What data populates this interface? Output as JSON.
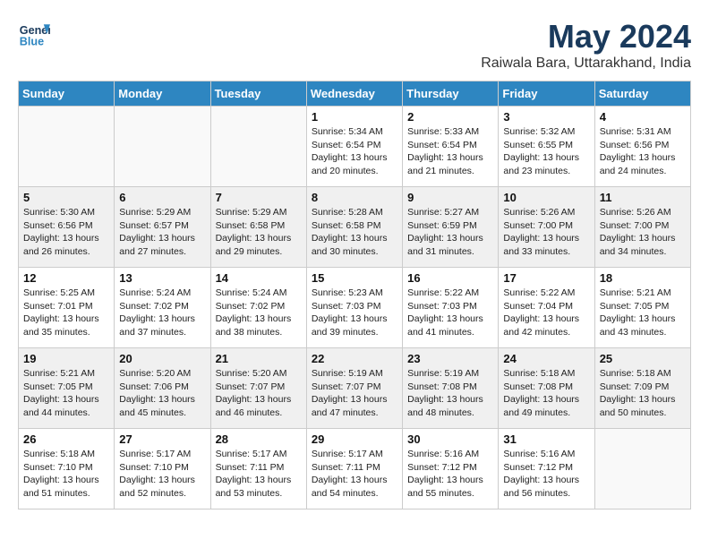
{
  "logo": {
    "line1": "General",
    "line2": "Blue"
  },
  "title": "May 2024",
  "location": "Raiwala Bara, Uttarakhand, India",
  "weekdays": [
    "Sunday",
    "Monday",
    "Tuesday",
    "Wednesday",
    "Thursday",
    "Friday",
    "Saturday"
  ],
  "weeks": [
    [
      {
        "day": "",
        "info": ""
      },
      {
        "day": "",
        "info": ""
      },
      {
        "day": "",
        "info": ""
      },
      {
        "day": "1",
        "info": "Sunrise: 5:34 AM\nSunset: 6:54 PM\nDaylight: 13 hours\nand 20 minutes."
      },
      {
        "day": "2",
        "info": "Sunrise: 5:33 AM\nSunset: 6:54 PM\nDaylight: 13 hours\nand 21 minutes."
      },
      {
        "day": "3",
        "info": "Sunrise: 5:32 AM\nSunset: 6:55 PM\nDaylight: 13 hours\nand 23 minutes."
      },
      {
        "day": "4",
        "info": "Sunrise: 5:31 AM\nSunset: 6:56 PM\nDaylight: 13 hours\nand 24 minutes."
      }
    ],
    [
      {
        "day": "5",
        "info": "Sunrise: 5:30 AM\nSunset: 6:56 PM\nDaylight: 13 hours\nand 26 minutes."
      },
      {
        "day": "6",
        "info": "Sunrise: 5:29 AM\nSunset: 6:57 PM\nDaylight: 13 hours\nand 27 minutes."
      },
      {
        "day": "7",
        "info": "Sunrise: 5:29 AM\nSunset: 6:58 PM\nDaylight: 13 hours\nand 29 minutes."
      },
      {
        "day": "8",
        "info": "Sunrise: 5:28 AM\nSunset: 6:58 PM\nDaylight: 13 hours\nand 30 minutes."
      },
      {
        "day": "9",
        "info": "Sunrise: 5:27 AM\nSunset: 6:59 PM\nDaylight: 13 hours\nand 31 minutes."
      },
      {
        "day": "10",
        "info": "Sunrise: 5:26 AM\nSunset: 7:00 PM\nDaylight: 13 hours\nand 33 minutes."
      },
      {
        "day": "11",
        "info": "Sunrise: 5:26 AM\nSunset: 7:00 PM\nDaylight: 13 hours\nand 34 minutes."
      }
    ],
    [
      {
        "day": "12",
        "info": "Sunrise: 5:25 AM\nSunset: 7:01 PM\nDaylight: 13 hours\nand 35 minutes."
      },
      {
        "day": "13",
        "info": "Sunrise: 5:24 AM\nSunset: 7:02 PM\nDaylight: 13 hours\nand 37 minutes."
      },
      {
        "day": "14",
        "info": "Sunrise: 5:24 AM\nSunset: 7:02 PM\nDaylight: 13 hours\nand 38 minutes."
      },
      {
        "day": "15",
        "info": "Sunrise: 5:23 AM\nSunset: 7:03 PM\nDaylight: 13 hours\nand 39 minutes."
      },
      {
        "day": "16",
        "info": "Sunrise: 5:22 AM\nSunset: 7:03 PM\nDaylight: 13 hours\nand 41 minutes."
      },
      {
        "day": "17",
        "info": "Sunrise: 5:22 AM\nSunset: 7:04 PM\nDaylight: 13 hours\nand 42 minutes."
      },
      {
        "day": "18",
        "info": "Sunrise: 5:21 AM\nSunset: 7:05 PM\nDaylight: 13 hours\nand 43 minutes."
      }
    ],
    [
      {
        "day": "19",
        "info": "Sunrise: 5:21 AM\nSunset: 7:05 PM\nDaylight: 13 hours\nand 44 minutes."
      },
      {
        "day": "20",
        "info": "Sunrise: 5:20 AM\nSunset: 7:06 PM\nDaylight: 13 hours\nand 45 minutes."
      },
      {
        "day": "21",
        "info": "Sunrise: 5:20 AM\nSunset: 7:07 PM\nDaylight: 13 hours\nand 46 minutes."
      },
      {
        "day": "22",
        "info": "Sunrise: 5:19 AM\nSunset: 7:07 PM\nDaylight: 13 hours\nand 47 minutes."
      },
      {
        "day": "23",
        "info": "Sunrise: 5:19 AM\nSunset: 7:08 PM\nDaylight: 13 hours\nand 48 minutes."
      },
      {
        "day": "24",
        "info": "Sunrise: 5:18 AM\nSunset: 7:08 PM\nDaylight: 13 hours\nand 49 minutes."
      },
      {
        "day": "25",
        "info": "Sunrise: 5:18 AM\nSunset: 7:09 PM\nDaylight: 13 hours\nand 50 minutes."
      }
    ],
    [
      {
        "day": "26",
        "info": "Sunrise: 5:18 AM\nSunset: 7:10 PM\nDaylight: 13 hours\nand 51 minutes."
      },
      {
        "day": "27",
        "info": "Sunrise: 5:17 AM\nSunset: 7:10 PM\nDaylight: 13 hours\nand 52 minutes."
      },
      {
        "day": "28",
        "info": "Sunrise: 5:17 AM\nSunset: 7:11 PM\nDaylight: 13 hours\nand 53 minutes."
      },
      {
        "day": "29",
        "info": "Sunrise: 5:17 AM\nSunset: 7:11 PM\nDaylight: 13 hours\nand 54 minutes."
      },
      {
        "day": "30",
        "info": "Sunrise: 5:16 AM\nSunset: 7:12 PM\nDaylight: 13 hours\nand 55 minutes."
      },
      {
        "day": "31",
        "info": "Sunrise: 5:16 AM\nSunset: 7:12 PM\nDaylight: 13 hours\nand 56 minutes."
      },
      {
        "day": "",
        "info": ""
      }
    ]
  ]
}
